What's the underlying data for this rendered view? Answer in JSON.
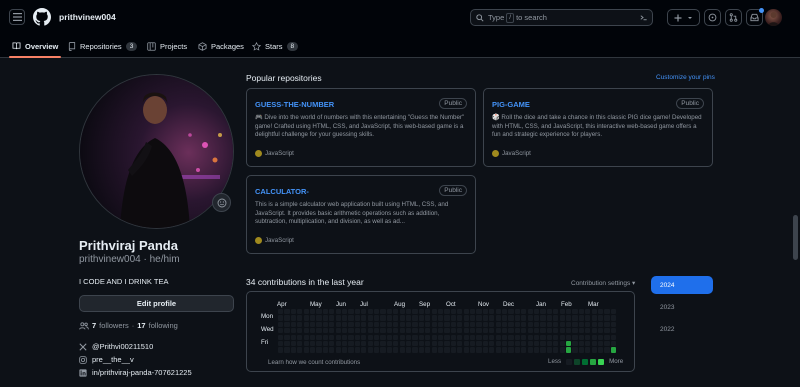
{
  "header": {
    "username": "prithvinew004",
    "search_prefix": "Type",
    "search_key": "/",
    "search_suffix": "to search"
  },
  "tabs": [
    {
      "label": "Overview",
      "count": ""
    },
    {
      "label": "Repositories",
      "count": "3"
    },
    {
      "label": "Projects",
      "count": ""
    },
    {
      "label": "Packages",
      "count": ""
    },
    {
      "label": "Stars",
      "count": "8"
    }
  ],
  "profile": {
    "full_name": "Prithviraj Panda",
    "handle": "prithvinew004 · he/him",
    "bio": "I CODE AND I DRINK TEA",
    "edit_label": "Edit profile",
    "followers": "7",
    "followers_label": "followers",
    "separator": "·",
    "following": "17",
    "following_label": "following",
    "twitter": "@Prithvi00211510",
    "instagram": "pre__the__v",
    "linkedin": "in/prithviraj-panda-707621225"
  },
  "popular": {
    "title": "Popular repositories",
    "customize": "Customize your pins",
    "repos": [
      {
        "name": "GUESS-THE-NUMBER",
        "visibility": "Public",
        "description": "🎮 Dive into the world of numbers with this entertaining \"Guess the Number\" game! Crafted using HTML, CSS, and JavaScript, this web-based game is a delightful challenge for your guessing skills.",
        "language": "JavaScript"
      },
      {
        "name": "PIG-GAME",
        "visibility": "Public",
        "description": "🎲 Roll the dice and take a chance in this classic PIG dice game! Developed with HTML, CSS, and JavaScript, this interactive web-based game offers a fun and strategic experience for players.",
        "language": "JavaScript"
      },
      {
        "name": "CALCULATOR-",
        "visibility": "Public",
        "description": "This is a simple calculator web application built using HTML, CSS, and JavaScript. It provides basic arithmetic operations such as addition, subtraction, multiplication, and division, as well as ad...",
        "language": "JavaScript"
      }
    ]
  },
  "contributions": {
    "title": "34 contributions in the last year",
    "settings": "Contribution settings ▾",
    "months": [
      "Apr",
      "May",
      "Jun",
      "Jul",
      "Aug",
      "Sep",
      "Oct",
      "Nov",
      "Dec",
      "Jan",
      "Feb",
      "Mar"
    ],
    "days": [
      "Mon",
      "Wed",
      "Fri"
    ],
    "learn": "Learn how we count contributions",
    "less": "Less",
    "more": "More",
    "years": [
      "2024",
      "2023",
      "2022"
    ],
    "active_cells": [
      {
        "week": 45,
        "day": 5,
        "level": 3
      },
      {
        "week": 45,
        "day": 6,
        "level": 3
      },
      {
        "week": 52,
        "day": 6,
        "level": 3
      }
    ],
    "colors": {
      "empty": "#161b22",
      "l1": "#0e4429",
      "l2": "#006d32",
      "l3": "#26a641",
      "l4": "#39d353"
    }
  },
  "colors": {
    "accent": "#4493f8",
    "tab_underline": "#f78166",
    "lang_js": "#a08a1e"
  }
}
